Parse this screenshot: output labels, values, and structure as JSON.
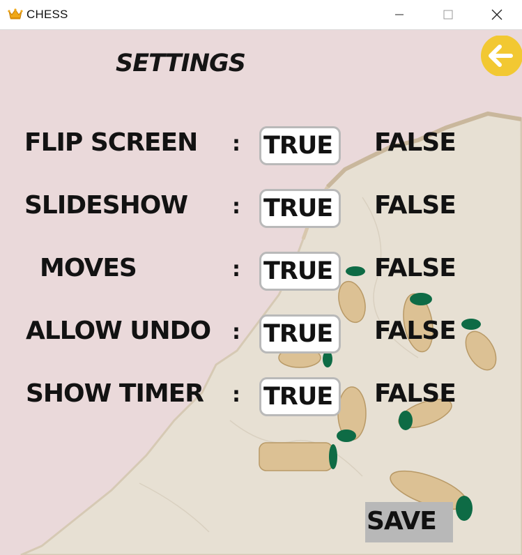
{
  "window": {
    "title": "CHESS",
    "app_icon": "crown-icon"
  },
  "window_controls": [
    "minimize-icon",
    "maximize-icon",
    "close-icon"
  ],
  "page": {
    "heading": "SETTINGS",
    "back_icon": "arrow-left-icon"
  },
  "settings": [
    {
      "label": "FLIP SCREEN",
      "separator": ":",
      "true_label": "TRUE",
      "false_label": "FALSE",
      "value": "TRUE"
    },
    {
      "label": "SLIDESHOW",
      "separator": ":",
      "true_label": "TRUE",
      "false_label": "FALSE",
      "value": "TRUE"
    },
    {
      "label": "MOVES",
      "separator": ":",
      "true_label": "TRUE",
      "false_label": "FALSE",
      "value": "TRUE"
    },
    {
      "label": "ALLOW UNDO",
      "separator": ":",
      "true_label": "TRUE",
      "false_label": "FALSE",
      "value": "TRUE"
    },
    {
      "label": "SHOW TIMER",
      "separator": ":",
      "true_label": "TRUE",
      "false_label": "FALSE",
      "value": "TRUE"
    }
  ],
  "actions": {
    "save_label": "SAVE"
  },
  "colors": {
    "background": "#ead9da",
    "marble": "#e6dfd2",
    "back_button": "#f2c832",
    "save_button": "#b8b8b8",
    "piece_felt": "#0e6b45"
  }
}
